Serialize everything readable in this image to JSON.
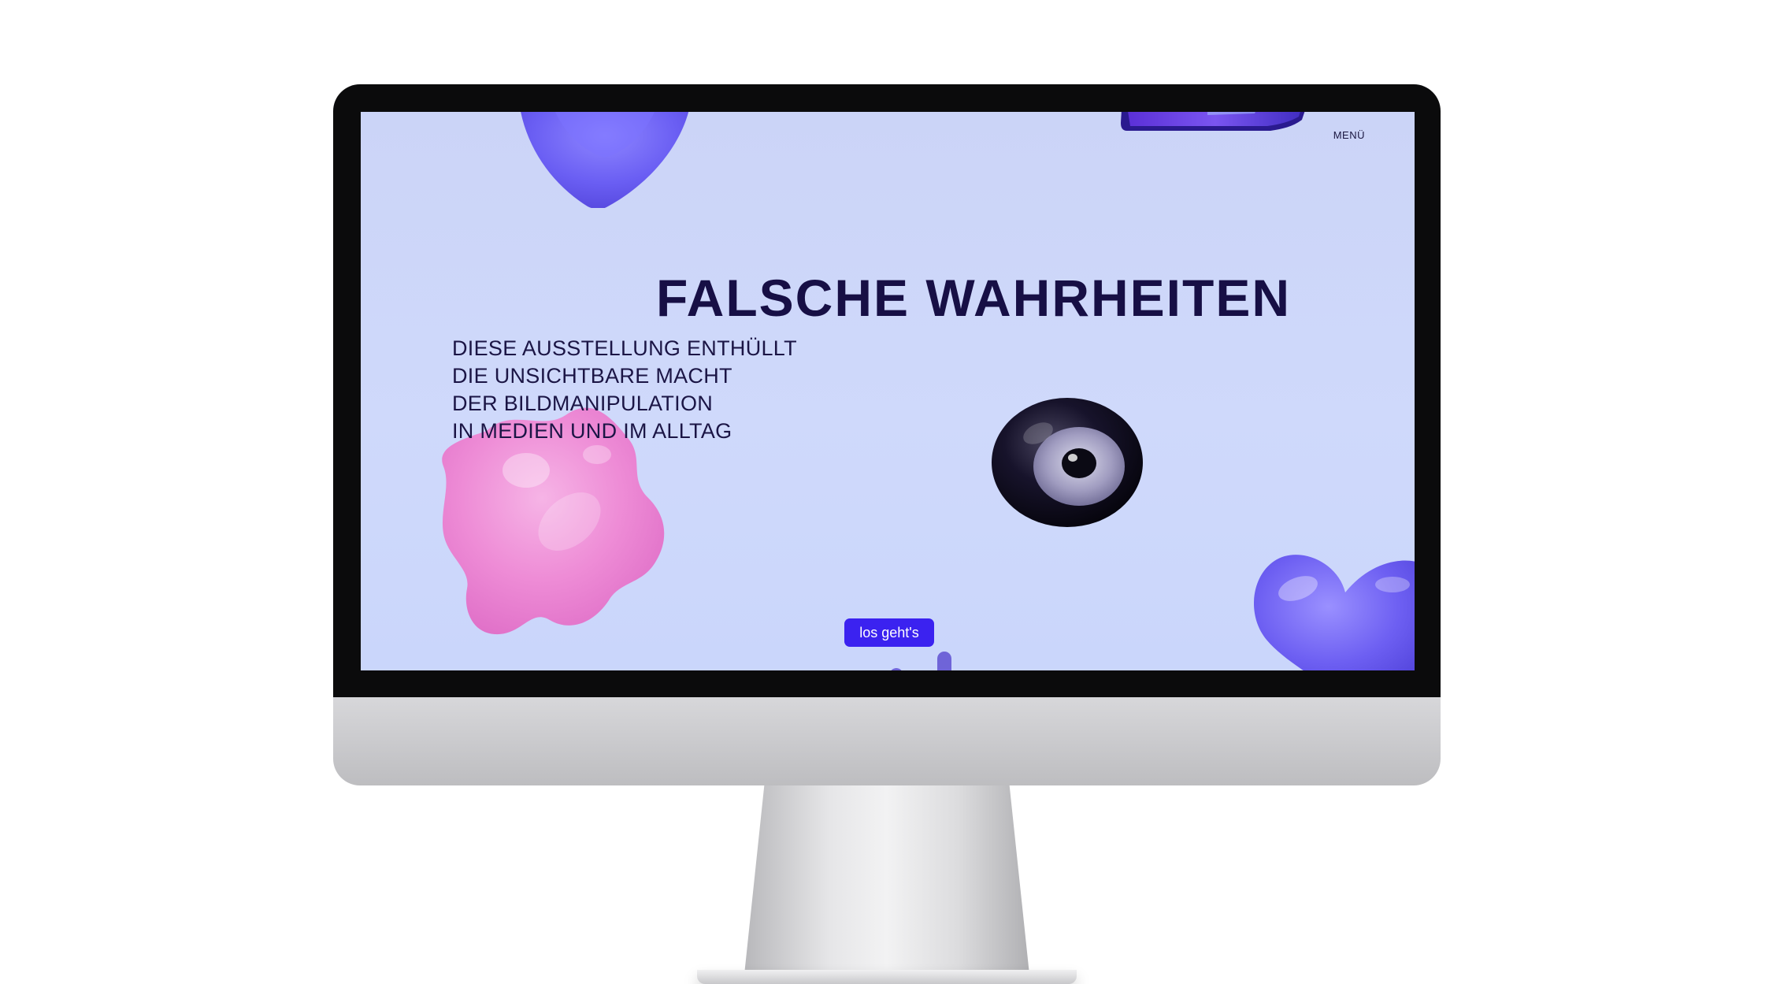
{
  "screen": {
    "menu_label": "MENÜ",
    "title": "FALSCHE WAHRHEITEN",
    "intro_lines": [
      "DIESE AUSSTELLUNG ENTHÜLLT",
      "DIE UNSICHTBARE MACHT",
      "DER BILDMANIPULATION",
      "IN MEDIEN UND IM ALLTAG"
    ],
    "cta_label": "los geht's"
  },
  "colors": {
    "background": "#cdd8fa",
    "title": "#170f45",
    "cta": "#3b22f0",
    "violet_shape": "#6a5cf2",
    "pink_blob": "#ef8fd6"
  },
  "icons": [
    "shield-shape",
    "gift-box-shape",
    "pink-blob-shape",
    "eye-shape",
    "heart-shape",
    "hand-shape"
  ]
}
